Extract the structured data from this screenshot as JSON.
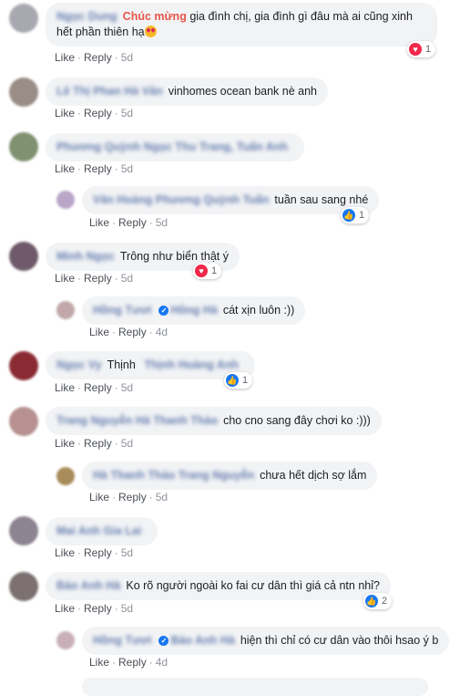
{
  "comments": [
    {
      "author": "Ngọc Dung",
      "highlight": "Chúc mừng",
      "text": " gia đình chị, gia đình gì đâu mà ai cũng xinh hết phần thiên hạ",
      "emoji": "heart-eyes-emoji",
      "like": "Like",
      "reply": "Reply",
      "time": "5d",
      "reaction": {
        "type": "love",
        "count": "1"
      },
      "avatar_color": "#a8a8b0"
    },
    {
      "author": "Lê Thị Phan Hà Vân",
      "text": "vinhomes ocean bank nè anh",
      "like": "Like",
      "reply": "Reply",
      "time": "5d",
      "avatar_color": "#9a8c86"
    },
    {
      "author": "Phương Quỳnh Ngọc Thu Trang, Tuấn Anh",
      "text": "",
      "like": "Like",
      "reply": "Reply",
      "time": "5d",
      "avatar_color": "#7f9170"
    },
    {
      "author": "Văn Hoàng Phương Quỳnh Tuấn",
      "text": "tuần sau sang nhé",
      "like": "Like",
      "reply": "Reply",
      "time": "5d",
      "reaction": {
        "type": "like",
        "count": "1"
      },
      "avatar_color": "#b9a6c8"
    },
    {
      "author": "Minh Ngọc",
      "text": "Trông như biển thật ý",
      "like": "Like",
      "reply": "Reply",
      "time": "5d",
      "reaction": {
        "type": "love",
        "count": "1"
      },
      "avatar_color": "#6e5a6a"
    },
    {
      "author": "Hồng Tươi",
      "verified": "✓",
      "author2": "Hồng Hà",
      "text": "cát xịn luôn :))",
      "like": "Like",
      "reply": "Reply",
      "time": "4d",
      "avatar_color": "#c2a8a8"
    },
    {
      "author": "Ngọc Vy",
      "text": "Thịnh",
      "author2": "Thịnh Hoàng Anh",
      "like": "Like",
      "reply": "Reply",
      "time": "5d",
      "reaction": {
        "type": "like",
        "count": "1"
      },
      "avatar_color": "#8a2b33"
    },
    {
      "author": "Trang Nguyễn Hà Thanh Thảo",
      "text": "cho cno sang đây chơi ko :)))",
      "like": "Like",
      "reply": "Reply",
      "time": "5d",
      "avatar_color": "#b79090"
    },
    {
      "author": "Hà Thanh Thảo Trang Nguyễn",
      "text": "chưa hết dịch sợ lắm",
      "like": "Like",
      "reply": "Reply",
      "time": "5d",
      "avatar_color": "#a88c5a"
    },
    {
      "author": "Mai Anh Gia Lai",
      "text": "",
      "like": "Like",
      "reply": "Reply",
      "time": "5d",
      "avatar_color": "#8c8490"
    },
    {
      "author": "Bảo Anh Hà",
      "text": "Ko rõ người ngoài ko fai cư dân thì giá cả ntn nhỉ?",
      "like": "Like",
      "reply": "Reply",
      "time": "5d",
      "reaction": {
        "type": "like",
        "count": "2"
      },
      "avatar_color": "#7c7070"
    },
    {
      "author": "Hồng Tươi",
      "verified": "✓",
      "author2": "Bảo Anh Hà",
      "text": "hiện thì chỉ có cư dân vào thôi hsao ý b",
      "like": "Like",
      "reply": "Reply",
      "time": "4d",
      "avatar_color": "#c9b0b8"
    }
  ]
}
